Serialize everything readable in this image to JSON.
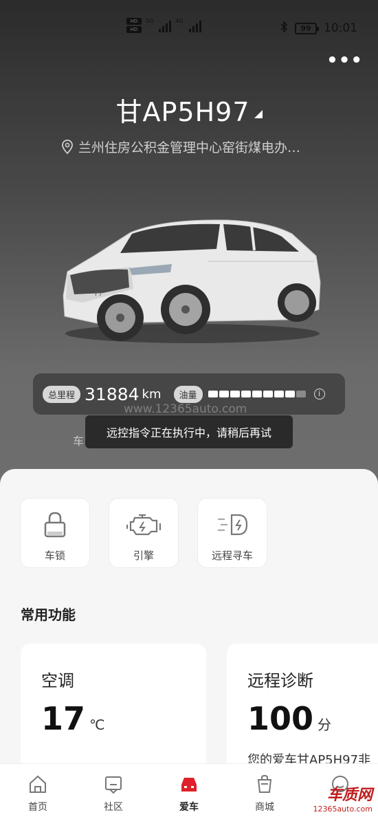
{
  "status_bar": {
    "hd_1": "HD",
    "hd_2": "HD",
    "net_1": "5G",
    "net_2": "4G",
    "battery": "99",
    "time": "10:01"
  },
  "header": {
    "more_label": "•••",
    "plate": "甘AP5H97",
    "location": "兰州住房公积金管理中心窑街煤电办…"
  },
  "car": {
    "badge_text": "F7"
  },
  "stats": {
    "mileage_label": "总里程",
    "mileage_value": "31884",
    "mileage_unit": "km",
    "fuel_label": "油量",
    "fuel_level": 0.9,
    "info_icon": "info-icon"
  },
  "watermark": "www.12365auto.com",
  "toast": {
    "prefix": "车",
    "message": "远控指令正在执行中，请稍后再试"
  },
  "controls": [
    {
      "label": "车锁",
      "icon": "lock-icon"
    },
    {
      "label": "引擎",
      "icon": "engine-icon"
    },
    {
      "label": "远程寻车",
      "icon": "find-car-icon"
    }
  ],
  "section": {
    "title": "常用功能"
  },
  "cards": [
    {
      "title": "空调",
      "value": "17",
      "unit": "℃",
      "sub": ""
    },
    {
      "title": "远程诊断",
      "value": "100",
      "unit": "分",
      "sub": "您的爱车甘AP5H97非"
    }
  ],
  "tabs": [
    {
      "label": "首页",
      "icon": "home-icon",
      "active": false
    },
    {
      "label": "社区",
      "icon": "community-icon",
      "active": false
    },
    {
      "label": "爱车",
      "icon": "car-icon",
      "active": true
    },
    {
      "label": "商城",
      "icon": "mall-icon",
      "active": false
    },
    {
      "label": "",
      "icon": "profile-icon",
      "active": false
    }
  ],
  "corner_logo": {
    "brand": "车质网",
    "url": "12365auto.com"
  },
  "colors": {
    "accent": "#e0202a",
    "dark_bg": "#2b2b2b"
  }
}
